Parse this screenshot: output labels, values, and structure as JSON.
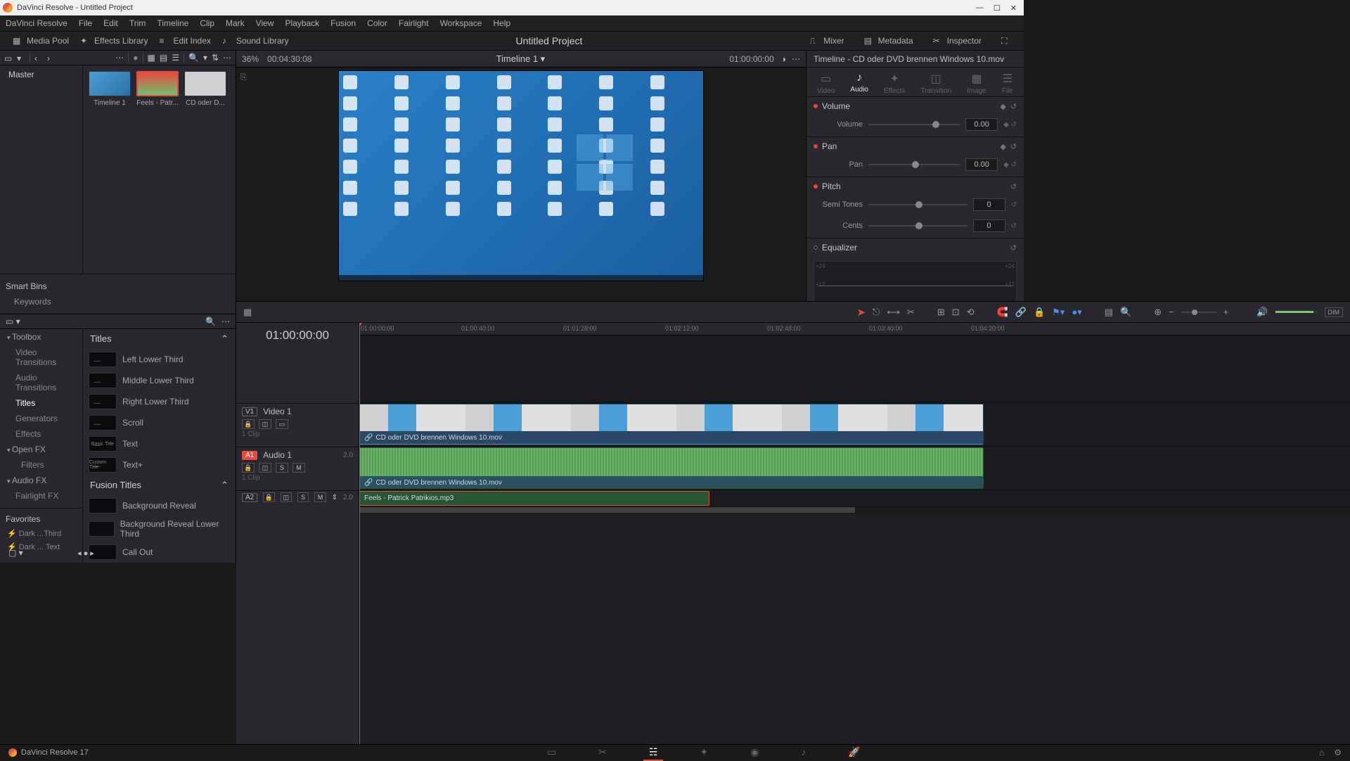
{
  "app": {
    "title": "DaVinci Resolve - Untitled Project",
    "version": "DaVinci Resolve 17"
  },
  "menus": [
    "DaVinci Resolve",
    "File",
    "Edit",
    "Trim",
    "Timeline",
    "Clip",
    "Mark",
    "View",
    "Playback",
    "Fusion",
    "Color",
    "Fairlight",
    "Workspace",
    "Help"
  ],
  "toolbar": {
    "media_pool": "Media Pool",
    "effects_lib": "Effects Library",
    "edit_index": "Edit Index",
    "sound_lib": "Sound Library",
    "project_title": "Untitled Project",
    "mixer": "Mixer",
    "metadata": "Metadata",
    "inspector": "Inspector"
  },
  "mediapool": {
    "master": "Master",
    "smart_bins": "Smart Bins",
    "keywords": "Keywords",
    "clips": [
      {
        "name": "Timeline 1"
      },
      {
        "name": "Feels - Patr..."
      },
      {
        "name": "CD oder D..."
      }
    ]
  },
  "fx": {
    "tree": {
      "toolbox": "Toolbox",
      "video_trans": "Video Transitions",
      "audio_trans": "Audio Transitions",
      "titles": "Titles",
      "generators": "Generators",
      "effects": "Effects",
      "openfx": "Open FX",
      "filters": "Filters",
      "audiofx": "Audio FX",
      "fairlightfx": "Fairlight FX",
      "favorites": "Favorites",
      "fav1": "Dark ...Third",
      "fav2": "Dark ... Text"
    },
    "group_titles": "Titles",
    "group_fusion": "Fusion Titles",
    "items": [
      "Left Lower Third",
      "Middle Lower Third",
      "Right Lower Third",
      "Scroll",
      "Text",
      "Text+"
    ],
    "fusion_items": [
      "Background Reveal",
      "Background Reveal Lower Third",
      "Call Out"
    ]
  },
  "viewer": {
    "zoom": "36%",
    "source_tc": "00:04:30:08",
    "timeline_name": "Timeline 1",
    "record_tc": "01:00:00:00"
  },
  "inspector": {
    "clip_title": "Timeline - CD oder DVD brennen Windows 10.mov",
    "tabs": {
      "video": "Video",
      "audio": "Audio",
      "effects": "Effects",
      "transition": "Transition",
      "image": "Image",
      "file": "File"
    },
    "volume": {
      "label": "Volume",
      "param": "Volume",
      "value": "0.00"
    },
    "pan": {
      "label": "Pan",
      "param": "Pan",
      "value": "0.00"
    },
    "pitch": {
      "label": "Pitch",
      "semi": "Semi Tones",
      "semi_val": "0",
      "cents": "Cents",
      "cents_val": "0"
    },
    "eq": {
      "label": "Equalizer"
    }
  },
  "timeline": {
    "tc": "01:00:00:00",
    "ruler": [
      "01:00:00:00",
      "01:00:40:00",
      "01:01:28:00",
      "01:02:12:00",
      "01:02:48:00",
      "01:03:40:00",
      "01:04:20:00"
    ],
    "v1": {
      "tag": "V1",
      "name": "Video 1",
      "clips": "1 Clip"
    },
    "a1": {
      "tag": "A1",
      "name": "Audio 1",
      "clips": "1 Clip",
      "ch": "2.0"
    },
    "a2": {
      "tag": "A2",
      "ch": "2.0"
    },
    "clip_video": "CD oder DVD brennen Windows 10.mov",
    "clip_audio1": "CD oder DVD brennen Windows 10.mov",
    "clip_audio2": "Feels - Patrick Patrikios.mp3"
  }
}
